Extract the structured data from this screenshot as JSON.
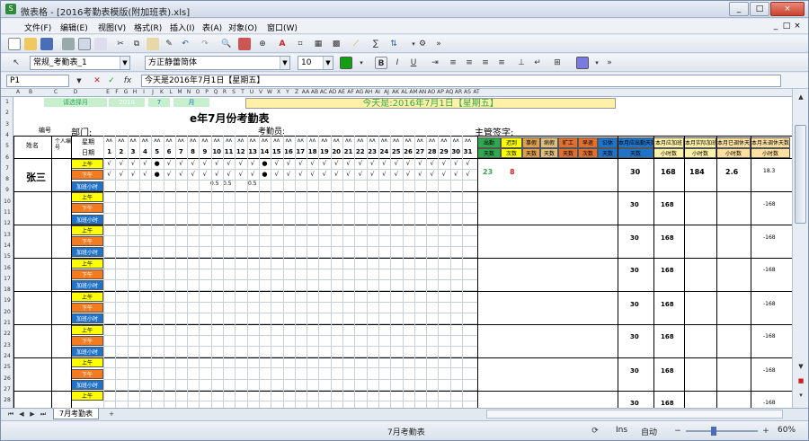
{
  "window": {
    "app_name": "微表格",
    "title": "微表格 - [2016考勤表模版(附加班表).xls]",
    "controls": [
      "_",
      "□",
      "×"
    ]
  },
  "menubar": {
    "items": [
      "文件(F)",
      "编辑(E)",
      "视图(V)",
      "格式(R)",
      "插入(I)",
      "表(A)",
      "对象(O)",
      "窗口(W)"
    ],
    "right_controls": [
      "_",
      "□",
      "×"
    ]
  },
  "toolbar2": {
    "style_value": "常规_考勤表_1",
    "font_value": "方正静蕾简体",
    "size_value": "10",
    "more": "»"
  },
  "toolbar1": {
    "more": "»"
  },
  "formula_bar": {
    "cell_ref": "P1",
    "fx": "fx",
    "content": "今天是2016年7月1日【星期五】"
  },
  "sheet": {
    "col_letters": [
      "A",
      "B",
      "C",
      "D",
      "E",
      "F",
      "G",
      "H",
      "I",
      "J",
      "K",
      "L",
      "M",
      "N",
      "O",
      "P",
      "Q",
      "R",
      "S",
      "T",
      "U",
      "V",
      "W",
      "X",
      "Y",
      "Z",
      "AA",
      "AB",
      "AC",
      "AD",
      "AE",
      "AF",
      "AG",
      "AH",
      "AI",
      "AJ",
      "AK",
      "AL",
      "AM",
      "AN",
      "AO",
      "AP",
      "AQ",
      "AR",
      "AS",
      "AT"
    ],
    "row_numbers": [
      "1",
      "2",
      "3",
      "4",
      "5",
      "6",
      "7",
      "8",
      "9",
      "10",
      "11",
      "12",
      "13",
      "14",
      "15",
      "16",
      "17",
      "18",
      "19",
      "20",
      "21",
      "22",
      "23",
      "24",
      "25",
      "26",
      "27",
      "28"
    ],
    "select_month_label": "请选择月",
    "year": "2016",
    "month": "7",
    "month_unit": "月",
    "today_text": "今天是:2016年7月1日【星期五】",
    "title": "e年7月份考勤表",
    "dept_label": "部门:",
    "clerk_label": "考勤员:",
    "supervisor_label": "主管签字:",
    "name_header": "姓名",
    "person_header": "个人编号",
    "day_header": "星期",
    "date_header": "日期",
    "days": [
      "1",
      "2",
      "3",
      "4",
      "5",
      "6",
      "7",
      "8",
      "9",
      "10",
      "11",
      "12",
      "13",
      "14",
      "15",
      "16",
      "17",
      "18",
      "19",
      "20",
      "21",
      "22",
      "23",
      "24",
      "25",
      "26",
      "27",
      "28",
      "29",
      "30",
      "31"
    ],
    "summary_headers": [
      "出勤",
      "迟到",
      "事假",
      "病假",
      "旷工",
      "早退",
      "公休",
      "本月应出勤天数",
      "本月应加班",
      "本月实际加班",
      "本月已调休天数",
      "本月未调休天数"
    ],
    "summary_subheaders": [
      "天数",
      "次数",
      "天数",
      "天数",
      "天数",
      "次数",
      "天数",
      "天数",
      "小时数",
      "小时数",
      "小时数",
      "小时数"
    ],
    "employee_name": "张三",
    "shift_labels": [
      "上午",
      "下午",
      "加班小时"
    ],
    "first_row_marks": [
      "√",
      "√",
      "√",
      "√",
      "●",
      "√",
      "√",
      "√",
      "√",
      "√",
      "√",
      "√",
      "√",
      "●",
      "√",
      "√",
      "√",
      "√",
      "√",
      "√",
      "√",
      "√",
      "√",
      "√",
      "√",
      "√",
      "√",
      "√",
      "√",
      "√",
      "√"
    ],
    "second_row_marks": [
      "√",
      "√",
      "√",
      "√",
      "●",
      "√",
      "√",
      "√",
      "√",
      "√",
      "√",
      "√",
      "√",
      "●",
      "√",
      "√",
      "√",
      "√",
      "√",
      "√",
      "√",
      "√",
      "√",
      "√",
      "√",
      "√",
      "√",
      "√",
      "√",
      "√",
      "√"
    ],
    "overtime_marks": [
      "0.5",
      "0.5",
      "0.5"
    ],
    "summary_values": {
      "attend": "23",
      "late": "8",
      "should_attend": "30",
      "should_ot": "168",
      "actual_ot": "184",
      "used_rest": "2.6",
      "unused_rest": "18.3"
    },
    "repeat_values": {
      "should_attend": "30",
      "should_ot": "168",
      "unused_rest": "-168"
    }
  },
  "sheet_tabs": {
    "active": "7月考勤表"
  },
  "statusbar": {
    "sheet": "7月考勤表",
    "mode": "Ins",
    "auto": "自动",
    "zoom": "60%"
  },
  "colors": {
    "yellow": "#ffff00",
    "orange": "#f47b20",
    "blue": "#1f73c8",
    "green": "#2fa84f",
    "light_green": "#c6efce",
    "light_yellow": "#fff2a8"
  }
}
